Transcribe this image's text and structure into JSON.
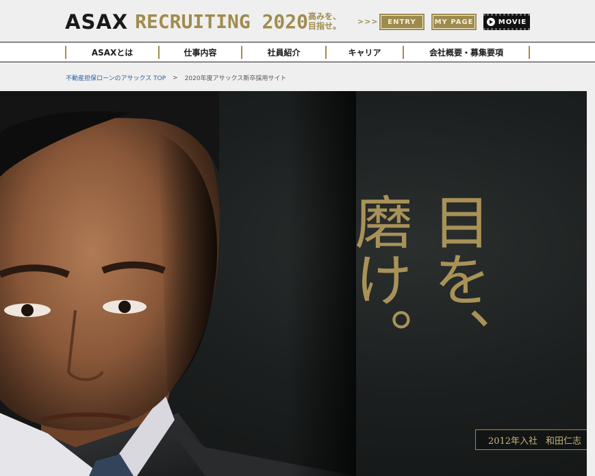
{
  "header": {
    "logo_asax": "ASAX",
    "logo_recruiting": "RECRUITING 2020",
    "tagline_line1": "高みを、",
    "tagline_line2": "目指せ。",
    "arrows": ">>>",
    "entry_label": "ENTRY",
    "mypage_label": "MY PAGE",
    "movie_label": "MOVIE"
  },
  "nav": {
    "items": [
      {
        "label": "ASAXとは"
      },
      {
        "label": "仕事内容"
      },
      {
        "label": "社員紹介"
      },
      {
        "label": "キャリア"
      },
      {
        "label": "会社概要・募集要項"
      }
    ]
  },
  "breadcrumb": {
    "home": "不動産担保ローンのアサックス TOP",
    "separator": ">",
    "current": "2020年度アサックス新卒採用サイト"
  },
  "hero": {
    "headline_col1": "目を、",
    "headline_col2": "磨け。",
    "caption_year": "2012年入社",
    "caption_name": "和田仁志"
  },
  "colors": {
    "gold": "#a08c4e",
    "dark": "#1a1a1a",
    "link": "#2a5fa0"
  }
}
